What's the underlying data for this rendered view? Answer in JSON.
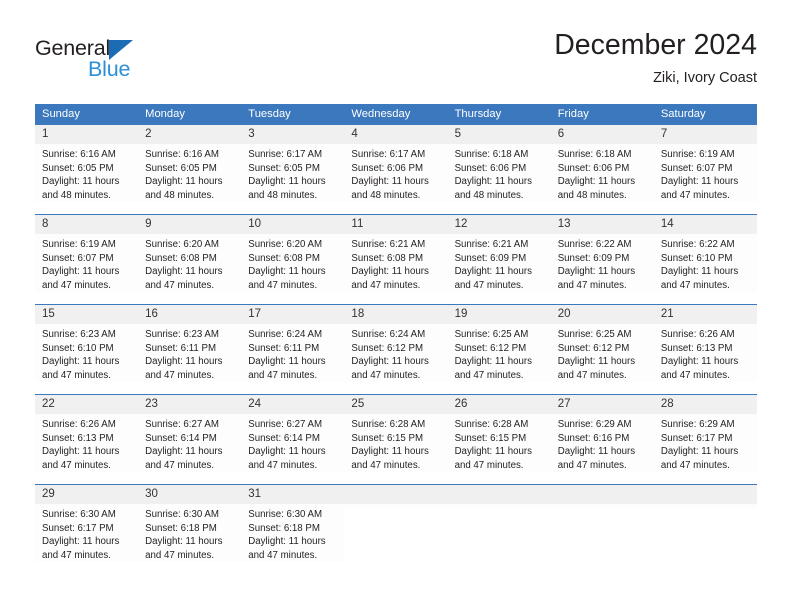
{
  "brand": {
    "logo_text_primary": "General",
    "logo_text_secondary": "Blue",
    "logo_icon": "triangle-icon",
    "primary_color": "#3b78bd",
    "logo_blue": "#2b8fd8",
    "header_bg": "#3b78bd",
    "daynum_bg": "#f0f0f0"
  },
  "header": {
    "title": "December 2024",
    "subtitle": "Ziki, Ivory Coast"
  },
  "calendar": {
    "weekday_headers": [
      "Sunday",
      "Monday",
      "Tuesday",
      "Wednesday",
      "Thursday",
      "Friday",
      "Saturday"
    ],
    "weeks": [
      [
        {
          "day": "1",
          "sunrise": "Sunrise: 6:16 AM",
          "sunset": "Sunset: 6:05 PM",
          "daylight1": "Daylight: 11 hours",
          "daylight2": "and 48 minutes."
        },
        {
          "day": "2",
          "sunrise": "Sunrise: 6:16 AM",
          "sunset": "Sunset: 6:05 PM",
          "daylight1": "Daylight: 11 hours",
          "daylight2": "and 48 minutes."
        },
        {
          "day": "3",
          "sunrise": "Sunrise: 6:17 AM",
          "sunset": "Sunset: 6:05 PM",
          "daylight1": "Daylight: 11 hours",
          "daylight2": "and 48 minutes."
        },
        {
          "day": "4",
          "sunrise": "Sunrise: 6:17 AM",
          "sunset": "Sunset: 6:06 PM",
          "daylight1": "Daylight: 11 hours",
          "daylight2": "and 48 minutes."
        },
        {
          "day": "5",
          "sunrise": "Sunrise: 6:18 AM",
          "sunset": "Sunset: 6:06 PM",
          "daylight1": "Daylight: 11 hours",
          "daylight2": "and 48 minutes."
        },
        {
          "day": "6",
          "sunrise": "Sunrise: 6:18 AM",
          "sunset": "Sunset: 6:06 PM",
          "daylight1": "Daylight: 11 hours",
          "daylight2": "and 48 minutes."
        },
        {
          "day": "7",
          "sunrise": "Sunrise: 6:19 AM",
          "sunset": "Sunset: 6:07 PM",
          "daylight1": "Daylight: 11 hours",
          "daylight2": "and 47 minutes."
        }
      ],
      [
        {
          "day": "8",
          "sunrise": "Sunrise: 6:19 AM",
          "sunset": "Sunset: 6:07 PM",
          "daylight1": "Daylight: 11 hours",
          "daylight2": "and 47 minutes."
        },
        {
          "day": "9",
          "sunrise": "Sunrise: 6:20 AM",
          "sunset": "Sunset: 6:08 PM",
          "daylight1": "Daylight: 11 hours",
          "daylight2": "and 47 minutes."
        },
        {
          "day": "10",
          "sunrise": "Sunrise: 6:20 AM",
          "sunset": "Sunset: 6:08 PM",
          "daylight1": "Daylight: 11 hours",
          "daylight2": "and 47 minutes."
        },
        {
          "day": "11",
          "sunrise": "Sunrise: 6:21 AM",
          "sunset": "Sunset: 6:08 PM",
          "daylight1": "Daylight: 11 hours",
          "daylight2": "and 47 minutes."
        },
        {
          "day": "12",
          "sunrise": "Sunrise: 6:21 AM",
          "sunset": "Sunset: 6:09 PM",
          "daylight1": "Daylight: 11 hours",
          "daylight2": "and 47 minutes."
        },
        {
          "day": "13",
          "sunrise": "Sunrise: 6:22 AM",
          "sunset": "Sunset: 6:09 PM",
          "daylight1": "Daylight: 11 hours",
          "daylight2": "and 47 minutes."
        },
        {
          "day": "14",
          "sunrise": "Sunrise: 6:22 AM",
          "sunset": "Sunset: 6:10 PM",
          "daylight1": "Daylight: 11 hours",
          "daylight2": "and 47 minutes."
        }
      ],
      [
        {
          "day": "15",
          "sunrise": "Sunrise: 6:23 AM",
          "sunset": "Sunset: 6:10 PM",
          "daylight1": "Daylight: 11 hours",
          "daylight2": "and 47 minutes."
        },
        {
          "day": "16",
          "sunrise": "Sunrise: 6:23 AM",
          "sunset": "Sunset: 6:11 PM",
          "daylight1": "Daylight: 11 hours",
          "daylight2": "and 47 minutes."
        },
        {
          "day": "17",
          "sunrise": "Sunrise: 6:24 AM",
          "sunset": "Sunset: 6:11 PM",
          "daylight1": "Daylight: 11 hours",
          "daylight2": "and 47 minutes."
        },
        {
          "day": "18",
          "sunrise": "Sunrise: 6:24 AM",
          "sunset": "Sunset: 6:12 PM",
          "daylight1": "Daylight: 11 hours",
          "daylight2": "and 47 minutes."
        },
        {
          "day": "19",
          "sunrise": "Sunrise: 6:25 AM",
          "sunset": "Sunset: 6:12 PM",
          "daylight1": "Daylight: 11 hours",
          "daylight2": "and 47 minutes."
        },
        {
          "day": "20",
          "sunrise": "Sunrise: 6:25 AM",
          "sunset": "Sunset: 6:12 PM",
          "daylight1": "Daylight: 11 hours",
          "daylight2": "and 47 minutes."
        },
        {
          "day": "21",
          "sunrise": "Sunrise: 6:26 AM",
          "sunset": "Sunset: 6:13 PM",
          "daylight1": "Daylight: 11 hours",
          "daylight2": "and 47 minutes."
        }
      ],
      [
        {
          "day": "22",
          "sunrise": "Sunrise: 6:26 AM",
          "sunset": "Sunset: 6:13 PM",
          "daylight1": "Daylight: 11 hours",
          "daylight2": "and 47 minutes."
        },
        {
          "day": "23",
          "sunrise": "Sunrise: 6:27 AM",
          "sunset": "Sunset: 6:14 PM",
          "daylight1": "Daylight: 11 hours",
          "daylight2": "and 47 minutes."
        },
        {
          "day": "24",
          "sunrise": "Sunrise: 6:27 AM",
          "sunset": "Sunset: 6:14 PM",
          "daylight1": "Daylight: 11 hours",
          "daylight2": "and 47 minutes."
        },
        {
          "day": "25",
          "sunrise": "Sunrise: 6:28 AM",
          "sunset": "Sunset: 6:15 PM",
          "daylight1": "Daylight: 11 hours",
          "daylight2": "and 47 minutes."
        },
        {
          "day": "26",
          "sunrise": "Sunrise: 6:28 AM",
          "sunset": "Sunset: 6:15 PM",
          "daylight1": "Daylight: 11 hours",
          "daylight2": "and 47 minutes."
        },
        {
          "day": "27",
          "sunrise": "Sunrise: 6:29 AM",
          "sunset": "Sunset: 6:16 PM",
          "daylight1": "Daylight: 11 hours",
          "daylight2": "and 47 minutes."
        },
        {
          "day": "28",
          "sunrise": "Sunrise: 6:29 AM",
          "sunset": "Sunset: 6:17 PM",
          "daylight1": "Daylight: 11 hours",
          "daylight2": "and 47 minutes."
        }
      ],
      [
        {
          "day": "29",
          "sunrise": "Sunrise: 6:30 AM",
          "sunset": "Sunset: 6:17 PM",
          "daylight1": "Daylight: 11 hours",
          "daylight2": "and 47 minutes."
        },
        {
          "day": "30",
          "sunrise": "Sunrise: 6:30 AM",
          "sunset": "Sunset: 6:18 PM",
          "daylight1": "Daylight: 11 hours",
          "daylight2": "and 47 minutes."
        },
        {
          "day": "31",
          "sunrise": "Sunrise: 6:30 AM",
          "sunset": "Sunset: 6:18 PM",
          "daylight1": "Daylight: 11 hours",
          "daylight2": "and 47 minutes."
        },
        {
          "day": "",
          "sunrise": "",
          "sunset": "",
          "daylight1": "",
          "daylight2": ""
        },
        {
          "day": "",
          "sunrise": "",
          "sunset": "",
          "daylight1": "",
          "daylight2": ""
        },
        {
          "day": "",
          "sunrise": "",
          "sunset": "",
          "daylight1": "",
          "daylight2": ""
        },
        {
          "day": "",
          "sunrise": "",
          "sunset": "",
          "daylight1": "",
          "daylight2": ""
        }
      ]
    ]
  }
}
